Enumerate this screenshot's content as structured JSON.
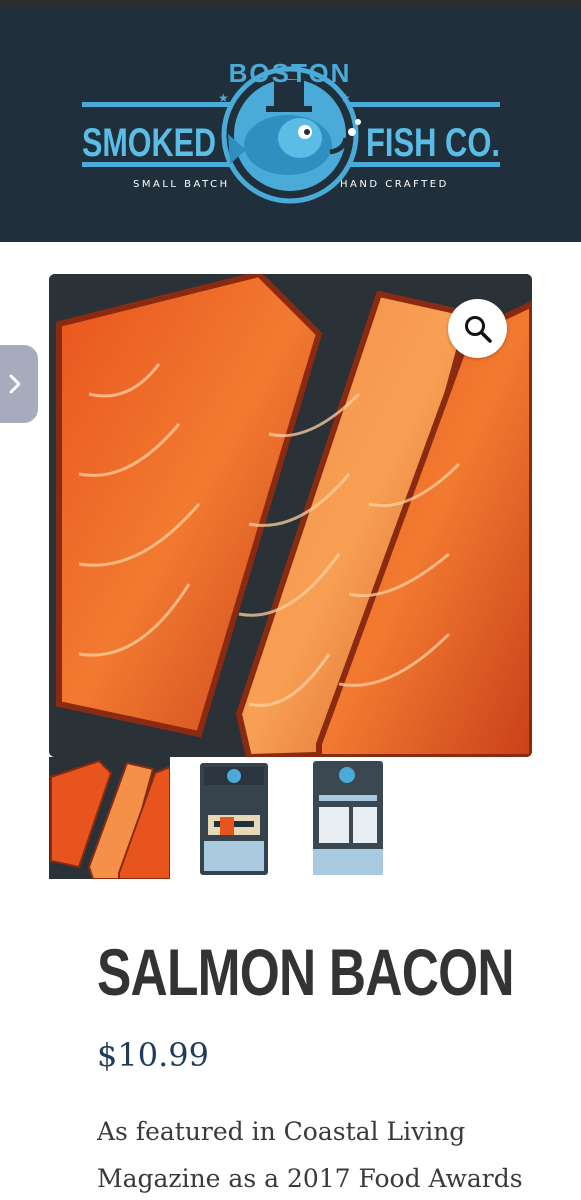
{
  "brand": {
    "top_word": "BOSTON",
    "left_word": "SMOKED",
    "right_word": "FISH CO.",
    "tagline_left": "SMALL BATCH",
    "tagline_right": "HAND CRAFTED",
    "colors": {
      "header_bg": "#1f2f3c",
      "accent": "#4aaad8"
    }
  },
  "gallery": {
    "zoom_icon": "magnifier-icon",
    "side_tab_icon": "chevron-right-icon",
    "thumbnails": [
      {
        "name": "thumb-salmon-fillets"
      },
      {
        "name": "thumb-package-front"
      },
      {
        "name": "thumb-package-back"
      }
    ]
  },
  "product": {
    "title": "SALMON BACON",
    "price": "$10.99",
    "description": "As featured in Coastal Living Magazine as a 2017 Food Awards"
  }
}
